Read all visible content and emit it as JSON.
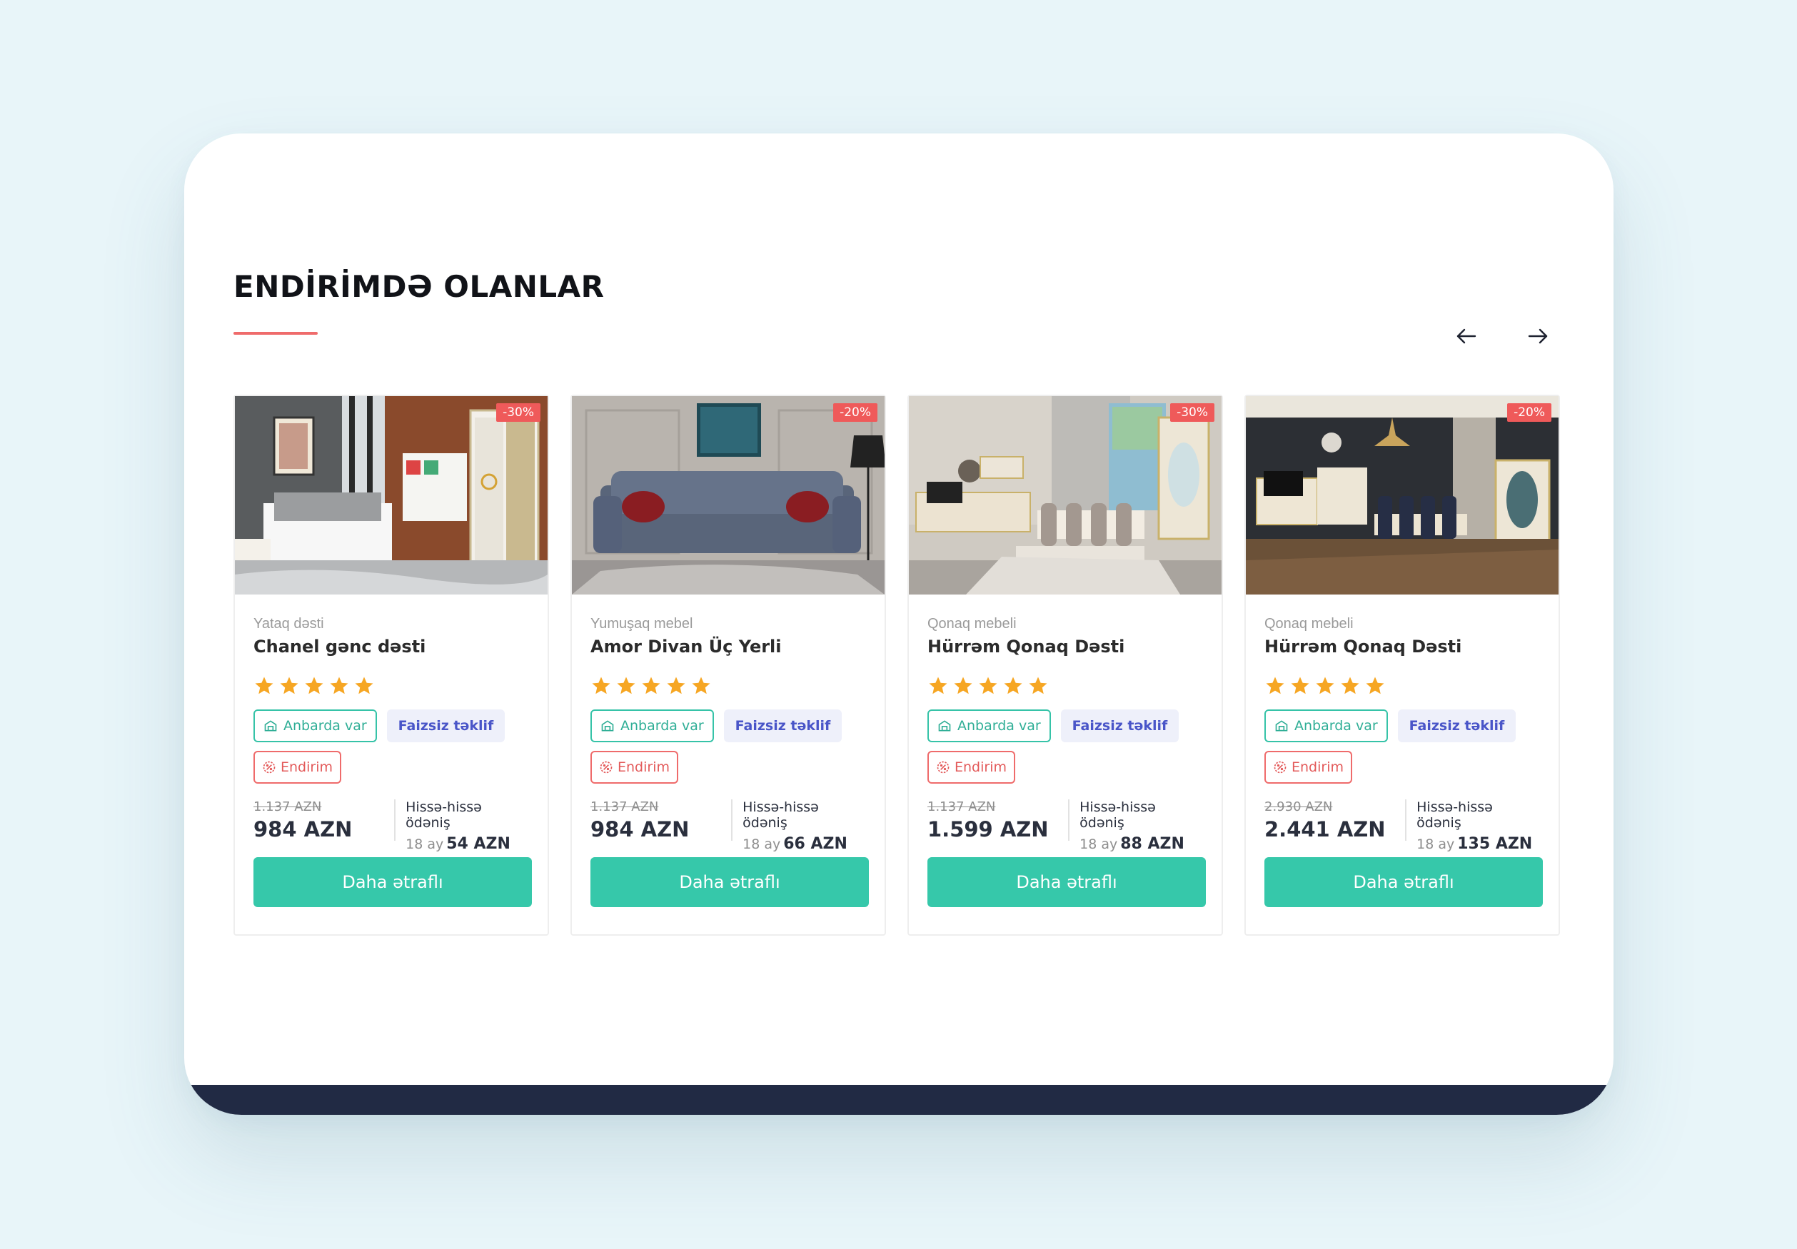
{
  "section": {
    "title": "ENDİRİMDƏ OLANLAR",
    "accent_color": "#ef6b6b"
  },
  "nav": {
    "prev_icon": "arrow-left-icon",
    "next_icon": "arrow-right-icon"
  },
  "colors": {
    "button": "#36c8aa",
    "badge": "#ef5a5a",
    "star": "#f6a623",
    "footer": "#212a44"
  },
  "products": [
    {
      "discount": "-30%",
      "category": "Yataq dəsti",
      "name": "Chanel gənc dəsti",
      "rating": 5,
      "stock_tag": "Anbarda var",
      "offer_tag": "Faizsiz təklif",
      "sale_tag": "Endirim",
      "old_price": "1.137 AZN",
      "new_price": "984 AZN",
      "installment_title": "Hissə-hissə ödəniş",
      "installment_months": "18 ay",
      "installment_amount": "54 AZN",
      "button": "Daha ətraflı"
    },
    {
      "discount": "-20%",
      "category": "Yumuşaq mebel",
      "name": "Amor Divan Üç Yerli",
      "rating": 5,
      "stock_tag": "Anbarda var",
      "offer_tag": "Faizsiz təklif",
      "sale_tag": "Endirim",
      "old_price": "1.137 AZN",
      "new_price": "984 AZN",
      "installment_title": "Hissə-hissə ödəniş",
      "installment_months": "18 ay",
      "installment_amount": "66 AZN",
      "button": "Daha ətraflı"
    },
    {
      "discount": "-30%",
      "category": "Qonaq mebeli",
      "name": "Hürrəm Qonaq Dəsti",
      "rating": 5,
      "stock_tag": "Anbarda var",
      "offer_tag": "Faizsiz təklif",
      "sale_tag": "Endirim",
      "old_price": "1.137 AZN",
      "new_price": "1.599 AZN",
      "installment_title": "Hissə-hissə ödəniş",
      "installment_months": "18 ay",
      "installment_amount": "88 AZN",
      "button": "Daha ətraflı"
    },
    {
      "discount": "-20%",
      "category": "Qonaq mebeli",
      "name": "Hürrəm Qonaq Dəsti",
      "rating": 5,
      "stock_tag": "Anbarda var",
      "offer_tag": "Faizsiz təklif",
      "sale_tag": "Endirim",
      "old_price": "2.930 AZN",
      "new_price": "2.441 AZN",
      "installment_title": "Hissə-hissə ödəniş",
      "installment_months": "18 ay",
      "installment_amount": "135 AZN",
      "button": "Daha ətraflı"
    }
  ]
}
